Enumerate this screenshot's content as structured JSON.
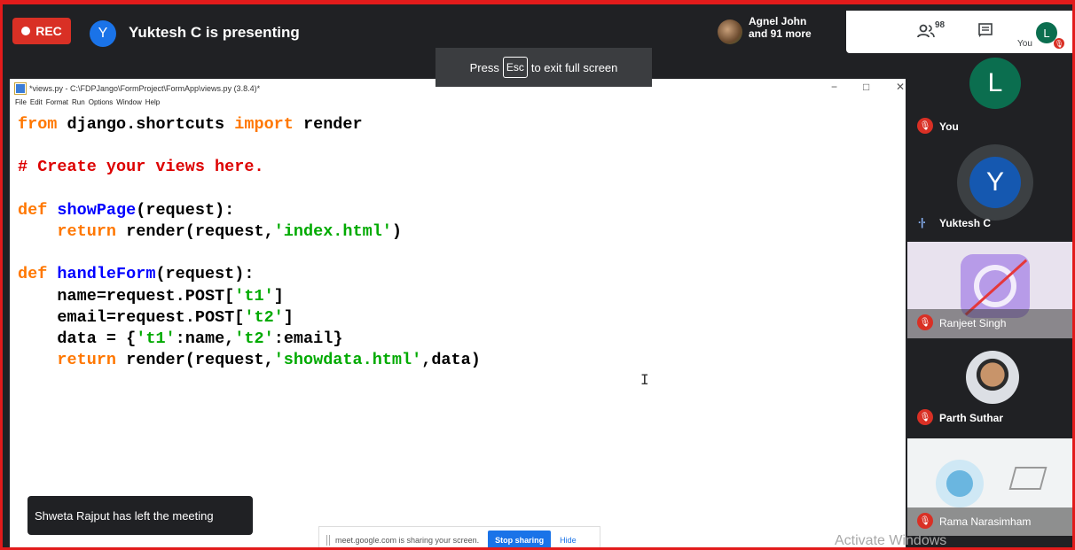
{
  "meet": {
    "rec_label": "REC",
    "presenter_initial": "Y",
    "presenting_text": "Yuktesh C is presenting",
    "people_line1": "Agnel John",
    "people_line2": "and 91 more",
    "participant_count": "98",
    "you_label": "You",
    "you_initial": "L"
  },
  "esc_banner": {
    "before": "Press",
    "key": "Esc",
    "after": "to exit full screen"
  },
  "idle": {
    "title": "*views.py - C:\\FDPJango\\FormProject\\FormApp\\views.py (3.8.4)*",
    "menu": [
      "File",
      "Edit",
      "Format",
      "Run",
      "Options",
      "Window",
      "Help"
    ],
    "win_controls": [
      "−",
      "□",
      "✕"
    ],
    "code": {
      "l1_kw1": "from",
      "l1_mid": " django.shortcuts ",
      "l1_kw2": "import",
      "l1_end": " render",
      "l3_comment": "# Create your views here.",
      "l5_kw": "def",
      "l5_fn": "showPage",
      "l5_end": "(request):",
      "l6_kw": "return",
      "l6_a": " render(request,",
      "l6_str": "'index.html'",
      "l6_end": ")",
      "l8_kw": "def",
      "l8_fn": "handleForm",
      "l8_end": "(request):",
      "l9_a": "name=request.POST[",
      "l9_str": "'t1'",
      "l9_end": "]",
      "l10_a": "email=request.POST[",
      "l10_str": "'t2'",
      "l10_end": "]",
      "l11_a": "data = {",
      "l11_s1": "'t1'",
      "l11_b": ":name,",
      "l11_s2": "'t2'",
      "l11_c": ":email}",
      "l12_kw": "return",
      "l12_a": " render(request,",
      "l12_str": "'showdata.html'",
      "l12_end": ",data)"
    }
  },
  "toast": "Shweta Rajput has left the meeting",
  "share_bar": {
    "text": "meet.google.com is sharing your screen.",
    "stop": "Stop sharing",
    "hide": "Hide"
  },
  "watermark": "Activate Windows",
  "participants": [
    {
      "name": "You",
      "initial": "L",
      "color": "#0b6e4f"
    },
    {
      "name": "Yuktesh C",
      "initial": "Y",
      "color": "#1558b0"
    },
    {
      "name": "Ranjeet Singh"
    },
    {
      "name": "Parth Suthar"
    },
    {
      "name": "Rama Narasimham"
    }
  ],
  "colors": {
    "rec": "#d93025",
    "keyword": "#ff7700",
    "function": "#0000ff",
    "comment": "#dd0000",
    "string": "#00aa00"
  }
}
